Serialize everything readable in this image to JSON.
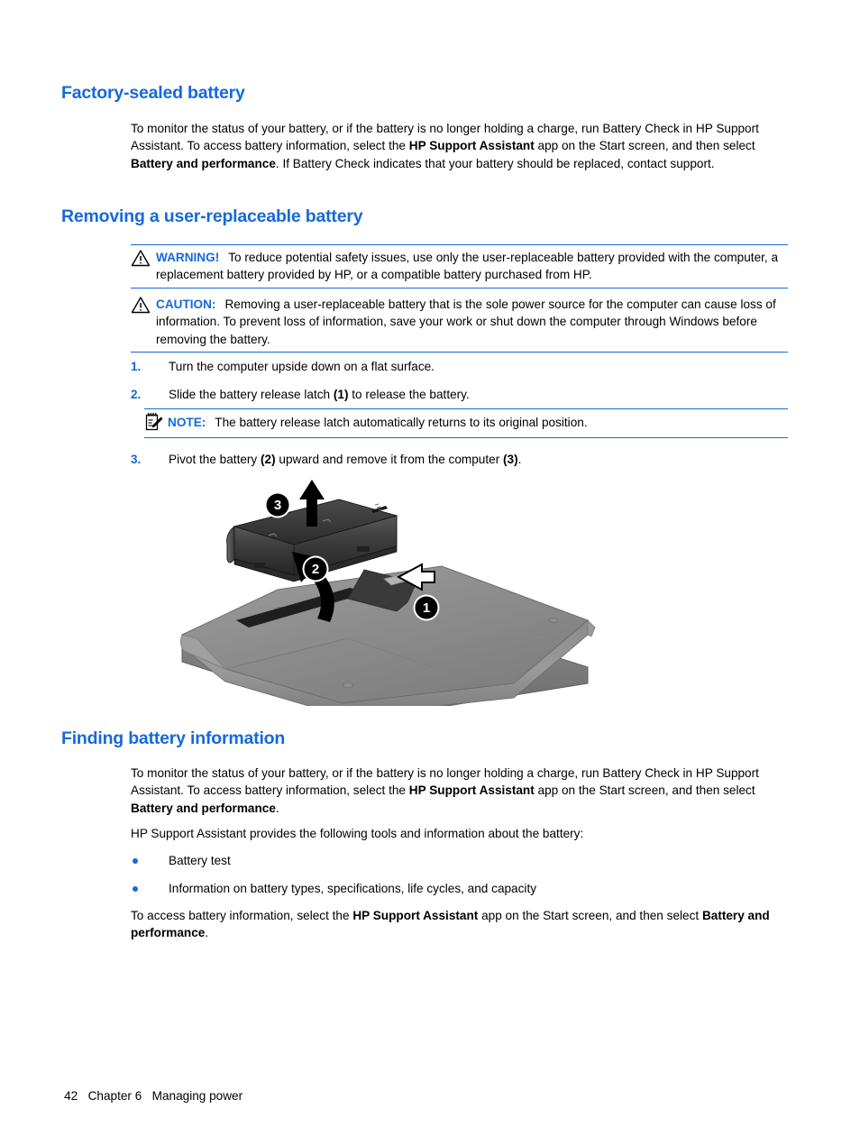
{
  "document": {
    "sections": [
      {
        "id": "factory-sealed-battery",
        "heading": "Factory-sealed battery"
      },
      {
        "id": "removing-user-replaceable-battery",
        "heading": "Removing a user-replaceable battery"
      },
      {
        "id": "finding-battery-information",
        "heading": "Finding battery information"
      }
    ]
  },
  "factory_sealed": {
    "heading": "Factory-sealed battery",
    "paragraph": {
      "part1": "To monitor the status of your battery, or if the battery is no longer holding a charge, run Battery Check in HP Support Assistant. To access battery information, select the ",
      "bold1": "HP Support Assistant",
      "part2": " app on the Start screen, and then select ",
      "bold2": "Battery and performance",
      "part3": ". If Battery Check indicates that your battery should be replaced, contact support."
    }
  },
  "removing_battery": {
    "heading": "Removing a user-replaceable battery",
    "warning": {
      "icon": "warning-triangle-icon",
      "keyword": "WARNING!",
      "text": "To reduce potential safety issues, use only the user-replaceable battery provided with the computer, a replacement battery provided by HP, or a compatible battery purchased from HP."
    },
    "caution": {
      "icon": "caution-triangle-icon",
      "keyword": "CAUTION:",
      "text": "Removing a user-replaceable battery that is the sole power source for the computer can cause loss of information. To prevent loss of information, save your work or shut down the computer through Windows before removing the battery."
    },
    "steps": [
      {
        "number": "1.",
        "part1": "Turn the computer upside down on a flat surface.",
        "bold1": "",
        "part2": "",
        "bold2": "",
        "part3": ""
      },
      {
        "number": "2.",
        "part1": "Slide the battery release latch ",
        "bold1": "(1)",
        "part2": " to release the battery.",
        "bold2": "",
        "part3": ""
      },
      {
        "number": "3.",
        "part1": "Pivot the battery ",
        "bold1": "(2)",
        "part2": " upward and remove it from the computer ",
        "bold2": "(3)",
        "part3": "."
      }
    ],
    "note": {
      "icon": "note-pad-pencil-icon",
      "keyword": "NOTE:",
      "text": "The battery release latch automatically returns to its original position."
    },
    "figure": {
      "name": "battery-removal-illustration",
      "alt": "Bottom view of a laptop with the battery being removed",
      "callouts": [
        {
          "label": "1",
          "meaning": "battery release latch slide direction"
        },
        {
          "label": "2",
          "meaning": "pivot the battery upward"
        },
        {
          "label": "3",
          "meaning": "remove the battery from the computer"
        }
      ]
    }
  },
  "finding_battery_info": {
    "heading": "Finding battery information",
    "paragraph1": {
      "part1": "To monitor the status of your battery, or if the battery is no longer holding a charge, run Battery Check in HP Support Assistant. To access battery information, select the ",
      "bold1": "HP Support Assistant",
      "part2": " app on the Start screen, and then select ",
      "bold2": "Battery and performance",
      "part3": "."
    },
    "paragraph2": "HP Support Assistant provides the following tools and information about the battery:",
    "bullets": [
      "Battery test",
      "Information on battery types, specifications, life cycles, and capacity"
    ],
    "paragraph3": {
      "part1": "To access battery information, select the ",
      "bold1": "HP Support Assistant",
      "part2": " app on the Start screen, and then select ",
      "bold2": "Battery and performance",
      "part3": "."
    }
  },
  "footer": {
    "page_number": "42",
    "chapter": "Chapter 6",
    "chapter_title": "Managing power"
  },
  "colors": {
    "heading_blue": "#1668dd",
    "rule_blue": "#1668dd",
    "bullet_blue": "#1668dd",
    "text_black": "#000000",
    "page_background": "#ffffff"
  }
}
